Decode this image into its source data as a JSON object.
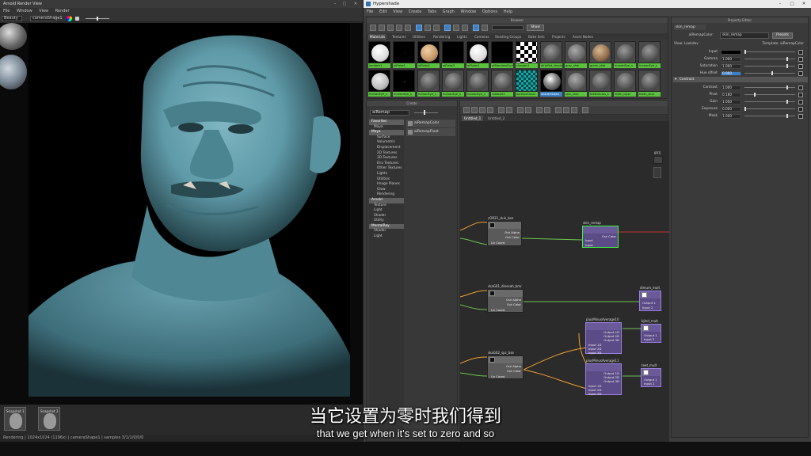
{
  "arnold": {
    "title": "Arnold Render View",
    "menu": [
      "File",
      "Window",
      "View",
      "Render"
    ],
    "aov_select": "Beauty",
    "camera_select": "cameraShape1",
    "snapshots": [
      "Snapshot 1",
      "Snapshot 2"
    ],
    "status": "Rendering | 1024x1024 (1196x) | cameraShape1 | samples 3/1/1/0/0/0"
  },
  "hypershade": {
    "title": "Hypershade",
    "menu": [
      "File",
      "Edit",
      "View",
      "Create",
      "Tabs",
      "Graph",
      "Window",
      "Options",
      "Help"
    ],
    "browser": {
      "header": "Browser",
      "show_label": "Show",
      "tabs": [
        "Materials",
        "Textures",
        "Utilities",
        "Rendering",
        "Lights",
        "Cameras",
        "Shading Groups",
        "Bake Sets",
        "Projects",
        "Asset Nodes"
      ],
      "row1": [
        "lambert1",
        "aiFlake1",
        "aiFlake2",
        "aiFlake3",
        "aiFlake4",
        "aiStandardSurface1",
        "checker1",
        "dirtyflat_shader",
        "grey_shdr",
        "gums_shdr",
        "humanEye_s",
        "humanEye_s"
      ],
      "row2": [
        "humanEye_s",
        "humanEye_s",
        "humanEye_s",
        "humanEye_s",
        "humanEye_s",
        "rambert1",
        "particleCloud",
        "shaderGlow1",
        "skin_shdr",
        "teethGums_s",
        "teeth_layer",
        "teeth_shdr"
      ]
    },
    "create": {
      "header": "Create",
      "search": "aiRemap",
      "tree": [
        {
          "label": "Favorites",
          "kind": "cat"
        },
        {
          "label": "Maya",
          "kind": "item"
        },
        {
          "label": "Maya",
          "kind": "cat"
        },
        {
          "label": "Surface",
          "kind": "sub"
        },
        {
          "label": "Volumetric",
          "kind": "sub"
        },
        {
          "label": "Displacement",
          "kind": "sub"
        },
        {
          "label": "2D Textures",
          "kind": "sub"
        },
        {
          "label": "3D Textures",
          "kind": "sub"
        },
        {
          "label": "Env Textures",
          "kind": "sub"
        },
        {
          "label": "Other Textures",
          "kind": "sub"
        },
        {
          "label": "Lights",
          "kind": "sub"
        },
        {
          "label": "Utilities",
          "kind": "sub"
        },
        {
          "label": "Image Planes",
          "kind": "sub"
        },
        {
          "label": "Glow",
          "kind": "sub"
        },
        {
          "label": "Rendering",
          "kind": "sub"
        },
        {
          "label": "Arnold",
          "kind": "cat"
        },
        {
          "label": "Texture",
          "kind": "item"
        },
        {
          "label": "Light",
          "kind": "item"
        },
        {
          "label": "Shader",
          "kind": "item"
        },
        {
          "label": "Utility",
          "kind": "item"
        },
        {
          "label": "MentalRay",
          "kind": "cat"
        },
        {
          "label": "Shader",
          "kind": "item"
        },
        {
          "label": "Light",
          "kind": "item"
        }
      ],
      "results": [
        "aiRemapColor",
        "aiRemapFloat"
      ]
    },
    "node_editor": {
      "tabs": [
        "Untitled_1",
        "Untitled_2"
      ],
      "nodes": {
        "n1": {
          "title": "cOR21_skin_bse",
          "ports": [
            "Out Alpha",
            "Out Color",
            "Uv Coord"
          ]
        },
        "n2": {
          "title": "skin_remap",
          "ports": [
            "Out Color",
            "Input",
            "Input"
          ]
        },
        "n3": {
          "title": "skaG01_dinosah_bmr",
          "ports": [
            "Out Alpha",
            "Out Color",
            "Uv Coord"
          ]
        },
        "n4": {
          "title": "dimum_mult",
          "ports": [
            "Output 1",
            "Input 2"
          ]
        },
        "n5": {
          "title": "plusMinusAverage10",
          "ports": [
            "Output 1D",
            "Output 2D",
            "Output 3D",
            "Input 1D",
            "Input 2D",
            "Input 3D"
          ]
        },
        "n6": {
          "title": "bjlnd_mult",
          "ports": [
            "Output 1",
            "Input 2"
          ]
        },
        "n7": {
          "title": "skaG02_spc_bse",
          "ports": [
            "Out Alpha",
            "Out Color",
            "Uv Coord"
          ]
        },
        "n8": {
          "title": "plusMinusAverage11",
          "ports": [
            "Output 1D",
            "Output 2D",
            "Output 3D",
            "Input 1D",
            "Input 2D",
            "Input 3D"
          ]
        },
        "n9": {
          "title": "teet_mult",
          "ports": [
            "Output 1",
            "Input 2"
          ]
        },
        "n10": {
          "title": "lPF5"
        }
      }
    },
    "property_editor": {
      "header": "Property Editor",
      "tab": "skin_remap",
      "node_label": "aiRemapColor:",
      "node_value": "skin_remap",
      "presets": "Presets",
      "view_label": "View: Lookdev",
      "template_label": "Template: aiRemapColor",
      "rows1": [
        {
          "label": "Input",
          "value": "",
          "knob": 0
        },
        {
          "label": "Gamma",
          "value": "1.000",
          "knob": 0.85
        },
        {
          "label": "Saturation",
          "value": "1.000",
          "knob": 0.85
        },
        {
          "label": "Hue offset",
          "value": "0.000",
          "knob": 0.55,
          "hl": true
        }
      ],
      "section": "Contrast",
      "rows2": [
        {
          "label": "Contrast",
          "value": "1.000",
          "knob": 0.85
        },
        {
          "label": "Pivot",
          "value": "0.180",
          "knob": 0.2
        },
        {
          "label": "Gain",
          "value": "1.000",
          "knob": 0.85
        },
        {
          "label": "Exposure",
          "value": "0.000",
          "knob": 0.0
        },
        {
          "label": "Mask",
          "value": "1.000",
          "knob": 0.85
        }
      ]
    }
  },
  "subtitle": {
    "zh": "当它设置为零时我们得到",
    "en": "that we get when it's set to zero and so"
  },
  "colors": {
    "skin": "#5f9aa8",
    "accent_green": "#5bc23d",
    "node_purple": "#5b4b86"
  }
}
